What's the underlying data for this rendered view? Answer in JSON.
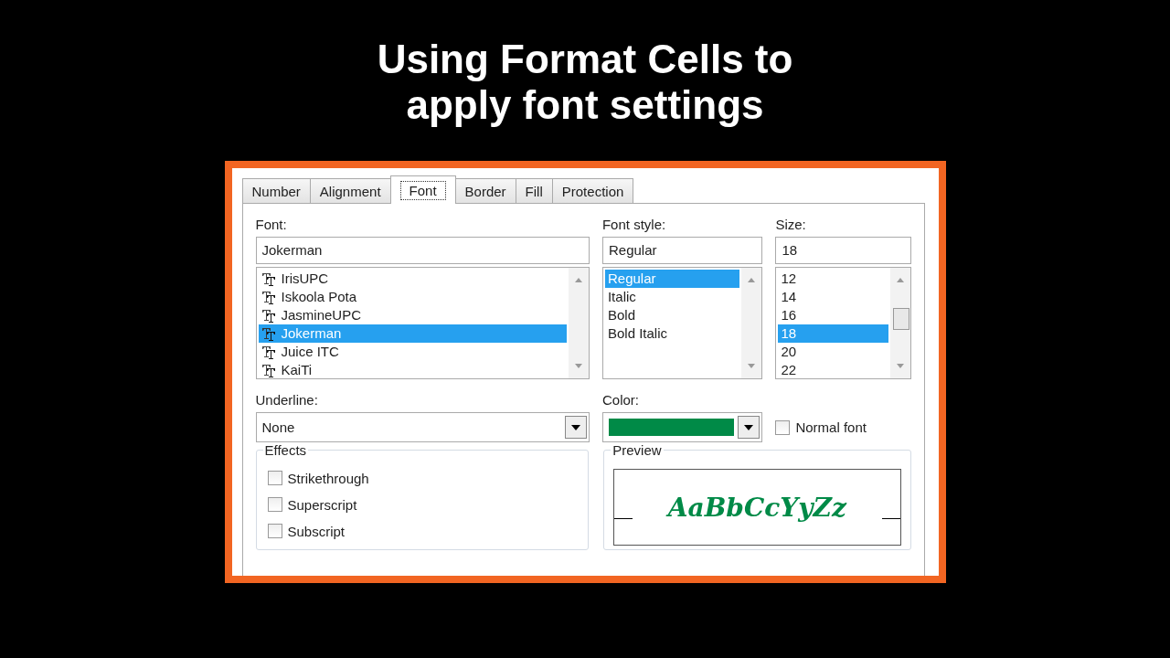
{
  "title_lines": [
    "Using Format Cells to",
    "apply font settings"
  ],
  "dialog": {
    "tabs": [
      {
        "label": "Number",
        "selected": false
      },
      {
        "label": "Alignment",
        "selected": false
      },
      {
        "label": "Font",
        "selected": true
      },
      {
        "label": "Border",
        "selected": false
      },
      {
        "label": "Fill",
        "selected": false
      },
      {
        "label": "Protection",
        "selected": false
      }
    ],
    "font": {
      "label": "Font:",
      "value": "Jokerman",
      "items": [
        {
          "label": "IrisUPC",
          "selected": false
        },
        {
          "label": "Iskoola Pota",
          "selected": false
        },
        {
          "label": "JasmineUPC",
          "selected": false
        },
        {
          "label": "Jokerman",
          "selected": true
        },
        {
          "label": "Juice ITC",
          "selected": false
        },
        {
          "label": "KaiTi",
          "selected": false
        }
      ]
    },
    "font_style": {
      "label": "Font style:",
      "value": "Regular",
      "items": [
        {
          "label": "Regular",
          "selected": true
        },
        {
          "label": "Italic",
          "selected": false
        },
        {
          "label": "Bold",
          "selected": false
        },
        {
          "label": "Bold Italic",
          "selected": false
        }
      ]
    },
    "size": {
      "label": "Size:",
      "value": "18",
      "items": [
        {
          "label": "12",
          "selected": false
        },
        {
          "label": "14",
          "selected": false
        },
        {
          "label": "16",
          "selected": false
        },
        {
          "label": "18",
          "selected": true
        },
        {
          "label": "20",
          "selected": false
        },
        {
          "label": "22",
          "selected": false
        }
      ]
    },
    "underline": {
      "label": "Underline:",
      "value": "None"
    },
    "color": {
      "label": "Color:",
      "color": "#008a47"
    },
    "normal_font": {
      "label": "Normal font",
      "checked": false
    },
    "effects": {
      "title": "Effects",
      "items": [
        {
          "label": "Strikethrough",
          "checked": false
        },
        {
          "label": "Superscript",
          "checked": false
        },
        {
          "label": "Subscript",
          "checked": false
        }
      ]
    },
    "preview": {
      "title": "Preview",
      "sample": "AaBbCcYyZz"
    }
  }
}
